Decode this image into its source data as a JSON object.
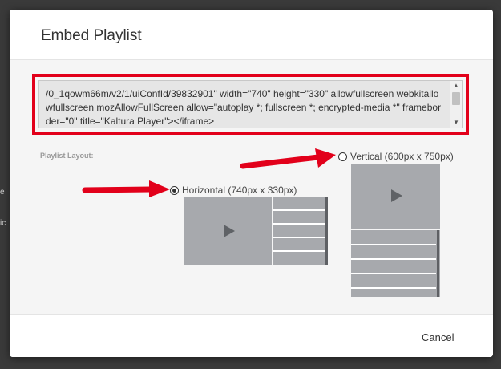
{
  "backdrop": {
    "fragment_1": "e",
    "fragment_2": "ic"
  },
  "dialog": {
    "title": "Embed Playlist",
    "embed_code": "/0_1qowm66m/v2/1/uiConfId/39832901\" width=\"740\" height=\"330\" allowfullscreen webkitallowfullscreen mozAllowFullScreen allow=\"autoplay *; fullscreen *; encrypted-media *\" frameborder=\"0\" title=\"Kaltura Player\"></iframe>",
    "layout_label": "Playlist Layout:",
    "options": [
      {
        "label": "Horizontal (740px x 330px)",
        "selected": true
      },
      {
        "label": "Vertical (600px x 750px)",
        "selected": false
      }
    ],
    "cancel_label": "Cancel"
  },
  "colors": {
    "highlight_border": "#e2001a",
    "annotation_arrow": "#e2001a",
    "preview_gray": "#a7a9ad"
  }
}
